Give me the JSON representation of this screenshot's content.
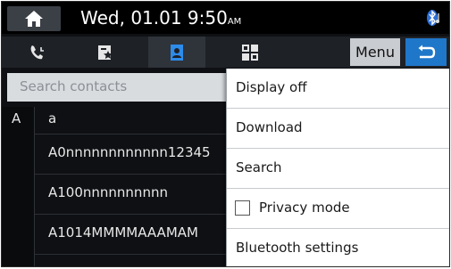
{
  "status": {
    "datetime": "Wed, 01.01  9:50",
    "ampm": "AM"
  },
  "tabs": [
    {
      "icon": "call-history-icon"
    },
    {
      "icon": "favorites-icon"
    },
    {
      "icon": "contacts-icon"
    },
    {
      "icon": "keypad-icon"
    }
  ],
  "toolbar": {
    "menu_label": "Menu"
  },
  "search": {
    "placeholder": "Search contacts"
  },
  "index": {
    "letter": "A"
  },
  "contacts": [
    "a",
    "A0nnnnnnnnnnnn12345",
    "A100nnnnnnnnnn",
    "A1014MMMMAAAMAM"
  ],
  "menu": {
    "items": [
      "Display off",
      "Download",
      "Search",
      "Privacy mode",
      "Bluetooth settings"
    ],
    "privacy_checked": false
  },
  "colors": {
    "accent": "#1f77c9",
    "menu_bg": "#ffffff",
    "screen_bg": "#0e1013"
  }
}
